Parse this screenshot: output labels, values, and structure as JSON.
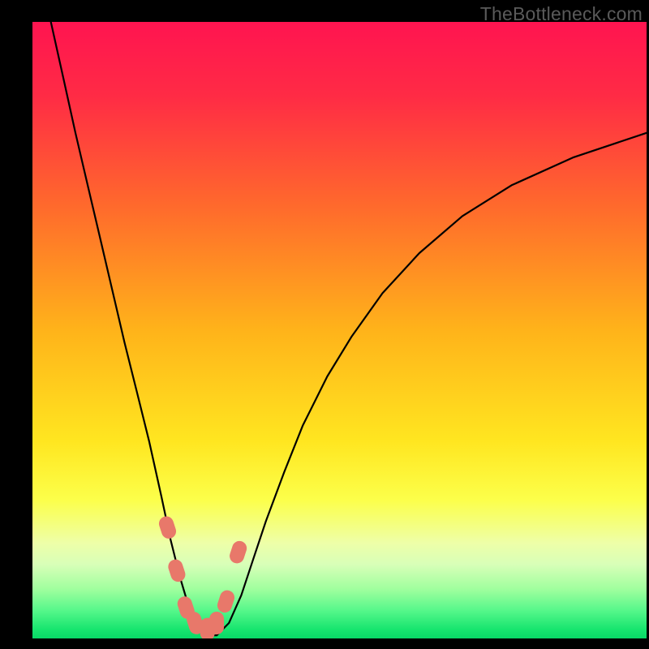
{
  "watermark": "TheBottleneck.com",
  "chart_data": {
    "type": "line",
    "title": "",
    "xlabel": "",
    "ylabel": "",
    "xlim": [
      0,
      100
    ],
    "ylim": [
      0,
      100
    ],
    "gradient_stops": [
      {
        "offset": 0.0,
        "color": "#ff1450"
      },
      {
        "offset": 0.12,
        "color": "#ff2b45"
      },
      {
        "offset": 0.3,
        "color": "#ff6a2c"
      },
      {
        "offset": 0.5,
        "color": "#ffb31a"
      },
      {
        "offset": 0.68,
        "color": "#ffe620"
      },
      {
        "offset": 0.775,
        "color": "#fcff4a"
      },
      {
        "offset": 0.81,
        "color": "#f5ff78"
      },
      {
        "offset": 0.845,
        "color": "#eeffa8"
      },
      {
        "offset": 0.88,
        "color": "#d8ffb8"
      },
      {
        "offset": 0.92,
        "color": "#a0ff9e"
      },
      {
        "offset": 0.955,
        "color": "#55f78a"
      },
      {
        "offset": 0.985,
        "color": "#18e56f"
      },
      {
        "offset": 1.0,
        "color": "#08d867"
      }
    ],
    "series": [
      {
        "name": "bottleneck-curve",
        "x": [
          3,
          5,
          7,
          9,
          11,
          13,
          15,
          17,
          19,
          21,
          22.5,
          24,
          25.5,
          27,
          28.5,
          30,
          32,
          34,
          36,
          38,
          41,
          44,
          48,
          52,
          57,
          63,
          70,
          78,
          88,
          100
        ],
        "y": [
          100,
          91,
          82,
          73.5,
          65,
          56.5,
          48,
          40,
          32,
          23,
          16,
          10,
          5,
          2,
          0.5,
          0.5,
          2.5,
          7,
          13,
          19,
          27,
          34.5,
          42.5,
          49,
          56,
          62.5,
          68.5,
          73.5,
          78,
          82
        ],
        "note": "y is percent bottleneck (0=green bottom, 100=red top); values estimated from pixel positions"
      }
    ],
    "markers": [
      {
        "x": 22.0,
        "y": 18.0
      },
      {
        "x": 23.5,
        "y": 11.0
      },
      {
        "x": 25.0,
        "y": 5.0
      },
      {
        "x": 26.5,
        "y": 2.5
      },
      {
        "x": 28.5,
        "y": 1.5
      },
      {
        "x": 30.0,
        "y": 2.5
      },
      {
        "x": 31.5,
        "y": 6.0
      },
      {
        "x": 33.5,
        "y": 14.0
      }
    ],
    "marker_color": "#e8786a",
    "curve_color": "#000000",
    "notes": "Chart has no visible axis ticks or labels; background is a vertical red→green gradient indicating severity; a thin black V-shaped curve dips near x≈28 where several salmon-colored rounded markers sit near the minimum."
  }
}
